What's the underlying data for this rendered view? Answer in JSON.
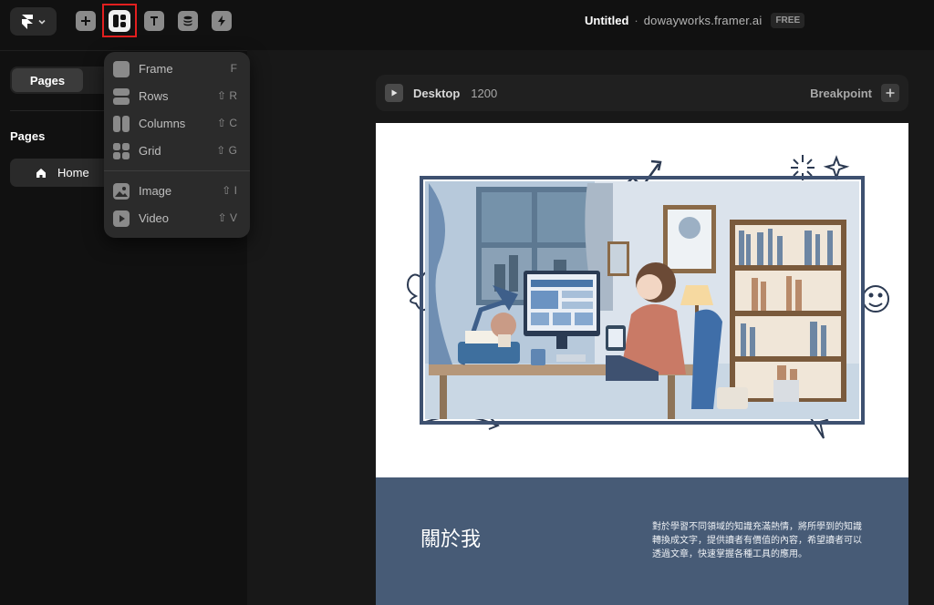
{
  "topbar": {
    "logo_icon": "framer-logo-icon",
    "tools": [
      {
        "name": "insert",
        "icon": "plus-icon"
      },
      {
        "name": "layout",
        "icon": "layout-icon",
        "selected": true
      },
      {
        "name": "text",
        "icon": "text-icon"
      },
      {
        "name": "cms",
        "icon": "database-icon"
      },
      {
        "name": "interactions",
        "icon": "lightning-icon"
      }
    ],
    "project_title": "Untitled",
    "separator": "·",
    "domain": "dowayworks.framer.ai",
    "plan_badge": "FREE"
  },
  "sidebar": {
    "tab_pages": "Pages",
    "section_title": "Pages",
    "items": [
      {
        "label": "Home",
        "icon": "home-icon"
      }
    ]
  },
  "layout_menu": {
    "groups": [
      [
        {
          "label": "Frame",
          "shortcut": "F",
          "icon": "frame-icon"
        },
        {
          "label": "Rows",
          "shortcut": "⇧ R",
          "icon": "rows-icon"
        },
        {
          "label": "Columns",
          "shortcut": "⇧ C",
          "icon": "columns-icon"
        },
        {
          "label": "Grid",
          "shortcut": "⇧ G",
          "icon": "grid-icon"
        }
      ],
      [
        {
          "label": "Image",
          "shortcut": "⇧ I",
          "icon": "image-icon"
        },
        {
          "label": "Video",
          "shortcut": "⇧ V",
          "icon": "video-icon"
        }
      ]
    ]
  },
  "breakpoint_bar": {
    "name": "Desktop",
    "width": "1200",
    "breakpoint_label": "Breakpoint"
  },
  "page_content": {
    "about_title": "關於我",
    "about_text": "對於學習不同領域的知識充滿熱情，將所學到的知識轉換成文字，提供讀者有價值的內容，希望讀者可以透過文章，快速掌握各種工具的應用。"
  },
  "colors": {
    "accent_highlight": "#e21f1f",
    "about_bg": "#475b76",
    "app_bg": "#111111"
  }
}
